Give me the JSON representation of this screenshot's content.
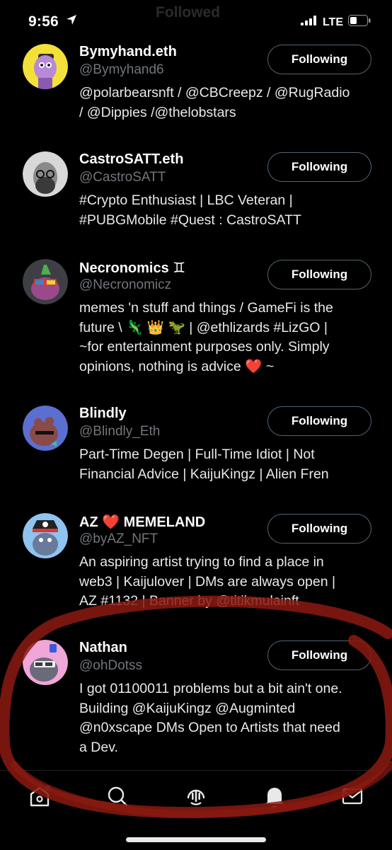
{
  "status_bar": {
    "time": "9:56",
    "network": "LTE"
  },
  "header_ghost": {
    "title": "Followed",
    "subtitle": ""
  },
  "accounts": [
    {
      "name": "Bymyhand.eth",
      "handle": "@Bymyhand6",
      "bio": [
        "@polarbearsnft / @CBCreepz / @RugRadio",
        "/ @Dippies /@thelobstars"
      ],
      "button": "Following",
      "avatar_color": "#f3e13a"
    },
    {
      "name": "CastroSATT.eth",
      "handle": "@CastroSATT",
      "bio": [
        "#Crypto Enthusiast | LBC Veteran |",
        "#PUBGMobile #Quest : CastroSATT"
      ],
      "button": "Following",
      "avatar_color": "#d8d8d8"
    },
    {
      "name": "Necronomics ♊",
      "handle": "@Necronomicz",
      "bio": [
        "memes 'n stuff and things / GameFi is the",
        "future \\ 🦎 👑 🦖  | @ethlizards #LizGO |",
        "~for entertainment purposes only. Simply",
        "opinions, nothing is advice ❤️ ~"
      ],
      "button": "Following",
      "avatar_color": "#3d3f45"
    },
    {
      "name": "Blindly",
      "handle": "@Blindly_Eth",
      "bio": [
        "Part-Time Degen | Full-Time Idiot | Not",
        "Financial Advice | KaijuKingz | Alien Fren"
      ],
      "button": "Following",
      "avatar_color": "#5a6fcf"
    },
    {
      "name": "AZ ❤️  MEMELAND",
      "handle": "@byAZ_NFT",
      "bio": [
        "An aspiring artist trying to find a place in",
        "web3 | Kaijulover | DMs are always open |",
        "AZ #1132 | Banner by @titikmulainft"
      ],
      "button": "Following",
      "avatar_color": "#8fc3f0"
    },
    {
      "name": "Nathan",
      "handle": "@ohDotss",
      "bio": [
        "I got 01100011 problems but a bit ain't one.",
        "Building @KaijuKingz @Augminted",
        "@n0xscape DMs Open to Artists that need",
        "a Dev."
      ],
      "button": "Following",
      "avatar_color": "#f0a6d8"
    }
  ],
  "tabs": [
    {
      "name": "home",
      "icon": "home-icon"
    },
    {
      "name": "search",
      "icon": "search-icon"
    },
    {
      "name": "spaces",
      "icon": "spaces-icon"
    },
    {
      "name": "notifications",
      "icon": "bell-icon"
    },
    {
      "name": "messages",
      "icon": "mail-icon"
    }
  ],
  "colors": {
    "background": "#000000",
    "annotation": "#8b1a10",
    "accent": "#1d9bf0"
  }
}
